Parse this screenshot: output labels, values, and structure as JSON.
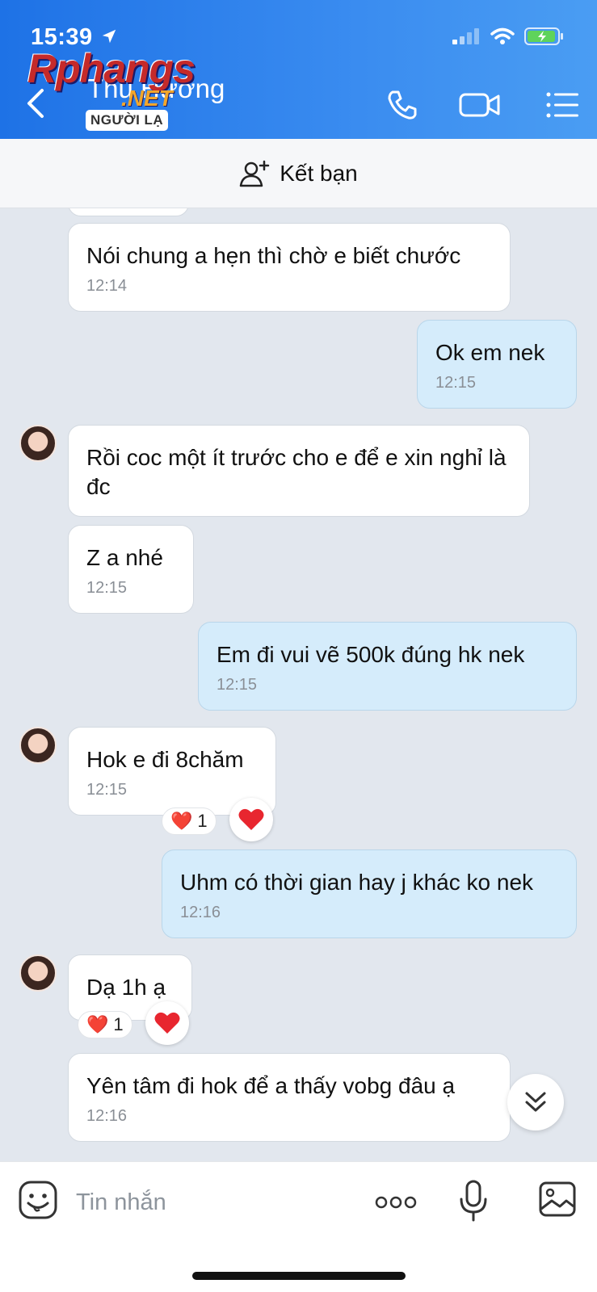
{
  "status": {
    "time": "15:39"
  },
  "header": {
    "contact_name": "Thu Hương",
    "badge": "NGƯỜI LẠ",
    "watermark": "Rphangs",
    "watermark_sub": ".NET",
    "accent": "#2f82ee"
  },
  "friend_bar": {
    "label": "Kết bạn"
  },
  "messages": [
    {
      "text": "",
      "time": ""
    },
    {
      "text": "Nói chung a hẹn thì chờ e biết chước",
      "time": "12:14"
    },
    {
      "text": "Ok em nek",
      "time": "12:15"
    },
    {
      "text": "Rồi coc một ít trước cho e để e xin nghỉ là đc",
      "time": ""
    },
    {
      "text": "Z a nhé",
      "time": "12:15"
    },
    {
      "text": "Em đi vui vẽ 500k đúng hk nek",
      "time": "12:15"
    },
    {
      "text": "Hok e đi 8chăm",
      "time": "12:15",
      "reaction": "❤️",
      "reaction_count": "1"
    },
    {
      "text": "Uhm có thời gian hay j khác ko nek",
      "time": "12:16"
    },
    {
      "text": "Dạ 1h ạ",
      "time": "",
      "reaction": "❤️",
      "reaction_count": "1"
    },
    {
      "text": "Yên tâm đi hok để a thấy vobg đâu ạ",
      "time": "12:16"
    }
  ],
  "input": {
    "placeholder": "Tin nhắn"
  },
  "colors": {
    "incoming_bubble": "#ffffff",
    "outgoing_bubble": "#d5ecfb",
    "chat_bg": "#e2e7ee"
  }
}
